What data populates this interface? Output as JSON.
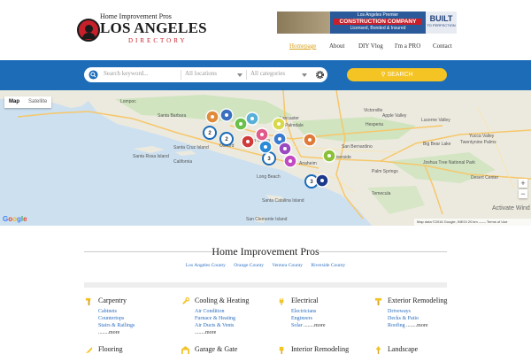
{
  "header": {
    "logo_tagline": "Home Improvement Pros",
    "logo_title": "LOS ANGELES",
    "logo_subtitle": "DIRECTORY",
    "ad": {
      "line1": "Los Angeles Premier",
      "line2": "CONSTRUCTION COMPANY",
      "line3": "Licensed, Bonded & Insured",
      "brand": "BUILT",
      "brand_sub": "TO PERFECTION"
    },
    "nav": [
      "Homepage",
      "About",
      "DIY Vlog",
      "I'm a PRO",
      "Contact"
    ]
  },
  "search": {
    "keyword_placeholder": "Search keyword...",
    "location_placeholder": "All locations",
    "category_placeholder": "All categories",
    "button_label": "SEARCH"
  },
  "map": {
    "toggle": [
      "Map",
      "Satellite"
    ],
    "places": [
      "Lompoc",
      "Santa Barbara",
      "Lancaster",
      "Palmdale",
      "Victorville",
      "Hesperia",
      "Apple Valley",
      "Lucerne Valley",
      "Big Bear Lake",
      "Yucca Valley",
      "Twentynine Palms",
      "Joshua Tree National Park",
      "Palm Springs",
      "Desert Center",
      "Temecula",
      "Riverside",
      "Long Beach",
      "Anaheim",
      "Oxnard",
      "San Bernardino",
      "Santa Clarita",
      "California",
      "Santa Catalina Island",
      "San Clemente Island",
      "Santa Rosa Island",
      "Santa Cruz Island"
    ],
    "cluster_labels": [
      "2",
      "2",
      "3",
      "3"
    ],
    "google_label": "Google",
    "footer": "Map data ©2016 Google, INEGI   20 km ——   Terms of Use",
    "activate": "Activate Wind",
    "zoom_in": "+",
    "zoom_out": "−"
  },
  "content": {
    "title": "Home Improvement Pros",
    "counties": [
      "Los Angeles County",
      "Orange County",
      "Ventura County",
      "Riverside County"
    ],
    "categories": [
      {
        "title": "Carpentry",
        "icon": "hammer-icon",
        "links": [
          "Cabinets",
          "Countertops",
          "Stairs & Railings"
        ],
        "more": "........more"
      },
      {
        "title": "Cooling & Heating",
        "icon": "wrench-icon",
        "links": [
          "Air Condition",
          "Furnace & Heating",
          "Air Ducts & Vents"
        ],
        "more": "........more"
      },
      {
        "title": "Electrical",
        "icon": "plug-icon",
        "links": [
          "Electricians",
          "Engineers"
        ],
        "inline_link": "Solar",
        "more": "........more"
      },
      {
        "title": "Exterior Remodeling",
        "icon": "brush-icon",
        "links": [
          "Driveways",
          "Decks & Patio"
        ],
        "inline_link": "Roofing",
        "more": "........more"
      },
      {
        "title": "Flooring",
        "icon": "trowel-icon",
        "links": [],
        "more": ""
      },
      {
        "title": "Garage & Gate",
        "icon": "garage-icon",
        "links": [],
        "more": ""
      },
      {
        "title": "Interior Remodeling",
        "icon": "paint-icon",
        "links": [],
        "more": ""
      },
      {
        "title": "Landscape",
        "icon": "shovel-icon",
        "links": [],
        "more": ""
      }
    ]
  },
  "colors": {
    "brand_blue": "#1c6cb8",
    "accent_yellow": "#f4c324",
    "link_blue": "#2a6dc0",
    "logo_red": "#c8202a"
  }
}
